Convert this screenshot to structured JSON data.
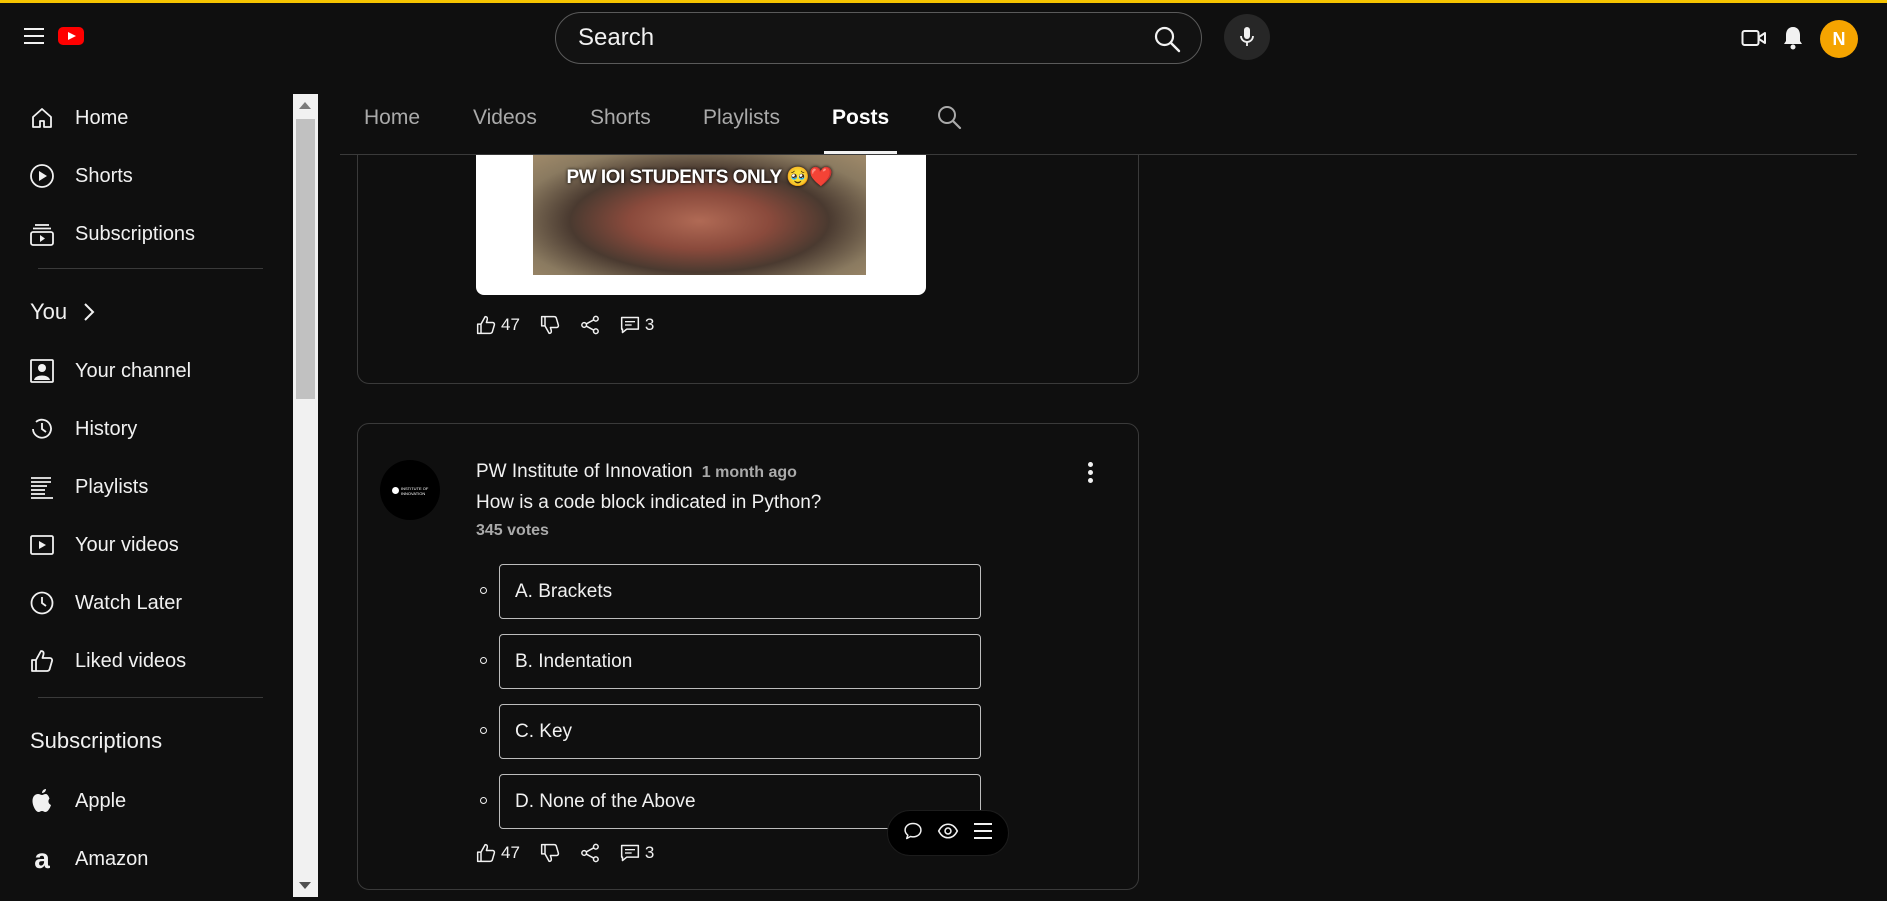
{
  "header": {
    "search_placeholder": "Search",
    "avatar_letter": "N",
    "icons": [
      "menu-icon",
      "youtube-logo",
      "search-icon",
      "mic-icon",
      "create-video-icon",
      "bell-icon"
    ]
  },
  "sidebar": {
    "main": [
      {
        "label": "Home",
        "icon": "home-icon"
      },
      {
        "label": "Shorts",
        "icon": "shorts-icon"
      },
      {
        "label": "Subscriptions",
        "icon": "subscriptions-icon"
      }
    ],
    "you_heading": "You",
    "you_items": [
      {
        "label": "Your channel",
        "icon": "your-channel-icon"
      },
      {
        "label": "History",
        "icon": "history-icon"
      },
      {
        "label": "Playlists",
        "icon": "playlists-icon"
      },
      {
        "label": "Your videos",
        "icon": "your-videos-icon"
      },
      {
        "label": "Watch Later",
        "icon": "watch-later-icon"
      },
      {
        "label": "Liked videos",
        "icon": "liked-videos-icon"
      }
    ],
    "subs_heading": "Subscriptions",
    "subs_items": [
      {
        "label": "Apple",
        "icon": "apple-icon"
      },
      {
        "label": "Amazon",
        "icon": "amazon-icon"
      }
    ]
  },
  "tabs": [
    {
      "label": "Home",
      "active": false
    },
    {
      "label": "Videos",
      "active": false
    },
    {
      "label": "Shorts",
      "active": false
    },
    {
      "label": "Playlists",
      "active": false
    },
    {
      "label": "Posts",
      "active": true
    }
  ],
  "post1": {
    "image_caption": "PW IOI STUDENTS ONLY 🥹❤️",
    "likes": "47",
    "comments": "3"
  },
  "post2": {
    "channel": "PW Institute of Innovation",
    "time": "1 month ago",
    "avatar_text": "INSTITUTE OF INNOVATION",
    "question": "How is a code block indicated in Python?",
    "votes": "345 votes",
    "options": [
      "A. Brackets",
      "B. Indentation",
      "C. Key",
      "D. None of the Above"
    ],
    "likes": "47",
    "comments": "3"
  },
  "floating_toolbar": {
    "icons": [
      "comment-bubble-icon",
      "eye-icon",
      "menu-lines-icon"
    ]
  },
  "colors": {
    "background": "#0f0f0f",
    "accent_stripe": "#f5c400",
    "avatar": "#f5a400",
    "logo_red": "#ff0000"
  }
}
